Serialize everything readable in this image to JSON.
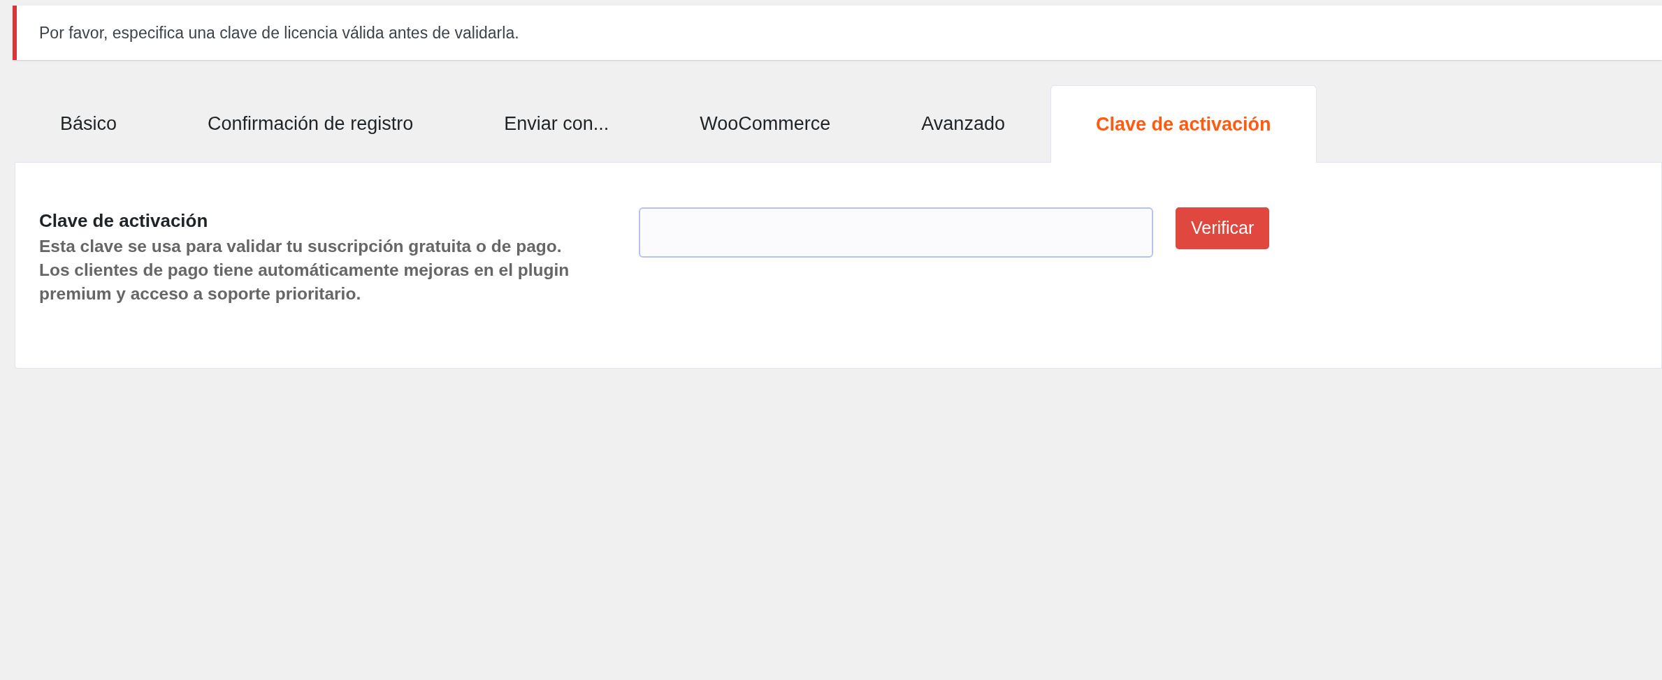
{
  "notice": {
    "text": "Por favor, especifica una clave de licencia válida antes de validarla."
  },
  "tabs": [
    {
      "label": "Básico",
      "selected": false
    },
    {
      "label": "Confirmación de registro",
      "selected": false
    },
    {
      "label": "Enviar con...",
      "selected": false
    },
    {
      "label": "WooCommerce",
      "selected": false
    },
    {
      "label": "Avanzado",
      "selected": false
    },
    {
      "label": "Clave de activación",
      "selected": true
    }
  ],
  "field": {
    "label": "Clave de activación",
    "description": "Esta clave se usa para validar tu suscripción gratuita o de pago. Los clientes de pago tiene automáticamente mejoras en el plugin premium y acceso a soporte prioritario."
  },
  "button": {
    "label": "Verificar"
  }
}
